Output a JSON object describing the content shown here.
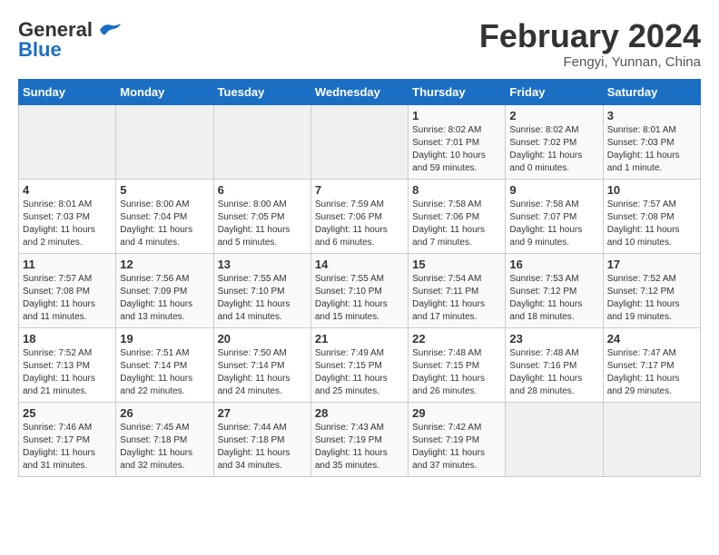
{
  "header": {
    "logo_general": "General",
    "logo_blue": "Blue",
    "month_title": "February 2024",
    "subtitle": "Fengyi, Yunnan, China"
  },
  "weekdays": [
    "Sunday",
    "Monday",
    "Tuesday",
    "Wednesday",
    "Thursday",
    "Friday",
    "Saturday"
  ],
  "weeks": [
    [
      {
        "day": "",
        "info": ""
      },
      {
        "day": "",
        "info": ""
      },
      {
        "day": "",
        "info": ""
      },
      {
        "day": "",
        "info": ""
      },
      {
        "day": "1",
        "info": "Sunrise: 8:02 AM\nSunset: 7:01 PM\nDaylight: 10 hours and 59 minutes."
      },
      {
        "day": "2",
        "info": "Sunrise: 8:02 AM\nSunset: 7:02 PM\nDaylight: 11 hours and 0 minutes."
      },
      {
        "day": "3",
        "info": "Sunrise: 8:01 AM\nSunset: 7:03 PM\nDaylight: 11 hours and 1 minute."
      }
    ],
    [
      {
        "day": "4",
        "info": "Sunrise: 8:01 AM\nSunset: 7:03 PM\nDaylight: 11 hours and 2 minutes."
      },
      {
        "day": "5",
        "info": "Sunrise: 8:00 AM\nSunset: 7:04 PM\nDaylight: 11 hours and 4 minutes."
      },
      {
        "day": "6",
        "info": "Sunrise: 8:00 AM\nSunset: 7:05 PM\nDaylight: 11 hours and 5 minutes."
      },
      {
        "day": "7",
        "info": "Sunrise: 7:59 AM\nSunset: 7:06 PM\nDaylight: 11 hours and 6 minutes."
      },
      {
        "day": "8",
        "info": "Sunrise: 7:58 AM\nSunset: 7:06 PM\nDaylight: 11 hours and 7 minutes."
      },
      {
        "day": "9",
        "info": "Sunrise: 7:58 AM\nSunset: 7:07 PM\nDaylight: 11 hours and 9 minutes."
      },
      {
        "day": "10",
        "info": "Sunrise: 7:57 AM\nSunset: 7:08 PM\nDaylight: 11 hours and 10 minutes."
      }
    ],
    [
      {
        "day": "11",
        "info": "Sunrise: 7:57 AM\nSunset: 7:08 PM\nDaylight: 11 hours and 11 minutes."
      },
      {
        "day": "12",
        "info": "Sunrise: 7:56 AM\nSunset: 7:09 PM\nDaylight: 11 hours and 13 minutes."
      },
      {
        "day": "13",
        "info": "Sunrise: 7:55 AM\nSunset: 7:10 PM\nDaylight: 11 hours and 14 minutes."
      },
      {
        "day": "14",
        "info": "Sunrise: 7:55 AM\nSunset: 7:10 PM\nDaylight: 11 hours and 15 minutes."
      },
      {
        "day": "15",
        "info": "Sunrise: 7:54 AM\nSunset: 7:11 PM\nDaylight: 11 hours and 17 minutes."
      },
      {
        "day": "16",
        "info": "Sunrise: 7:53 AM\nSunset: 7:12 PM\nDaylight: 11 hours and 18 minutes."
      },
      {
        "day": "17",
        "info": "Sunrise: 7:52 AM\nSunset: 7:12 PM\nDaylight: 11 hours and 19 minutes."
      }
    ],
    [
      {
        "day": "18",
        "info": "Sunrise: 7:52 AM\nSunset: 7:13 PM\nDaylight: 11 hours and 21 minutes."
      },
      {
        "day": "19",
        "info": "Sunrise: 7:51 AM\nSunset: 7:14 PM\nDaylight: 11 hours and 22 minutes."
      },
      {
        "day": "20",
        "info": "Sunrise: 7:50 AM\nSunset: 7:14 PM\nDaylight: 11 hours and 24 minutes."
      },
      {
        "day": "21",
        "info": "Sunrise: 7:49 AM\nSunset: 7:15 PM\nDaylight: 11 hours and 25 minutes."
      },
      {
        "day": "22",
        "info": "Sunrise: 7:48 AM\nSunset: 7:15 PM\nDaylight: 11 hours and 26 minutes."
      },
      {
        "day": "23",
        "info": "Sunrise: 7:48 AM\nSunset: 7:16 PM\nDaylight: 11 hours and 28 minutes."
      },
      {
        "day": "24",
        "info": "Sunrise: 7:47 AM\nSunset: 7:17 PM\nDaylight: 11 hours and 29 minutes."
      }
    ],
    [
      {
        "day": "25",
        "info": "Sunrise: 7:46 AM\nSunset: 7:17 PM\nDaylight: 11 hours and 31 minutes."
      },
      {
        "day": "26",
        "info": "Sunrise: 7:45 AM\nSunset: 7:18 PM\nDaylight: 11 hours and 32 minutes."
      },
      {
        "day": "27",
        "info": "Sunrise: 7:44 AM\nSunset: 7:18 PM\nDaylight: 11 hours and 34 minutes."
      },
      {
        "day": "28",
        "info": "Sunrise: 7:43 AM\nSunset: 7:19 PM\nDaylight: 11 hours and 35 minutes."
      },
      {
        "day": "29",
        "info": "Sunrise: 7:42 AM\nSunset: 7:19 PM\nDaylight: 11 hours and 37 minutes."
      },
      {
        "day": "",
        "info": ""
      },
      {
        "day": "",
        "info": ""
      }
    ]
  ]
}
